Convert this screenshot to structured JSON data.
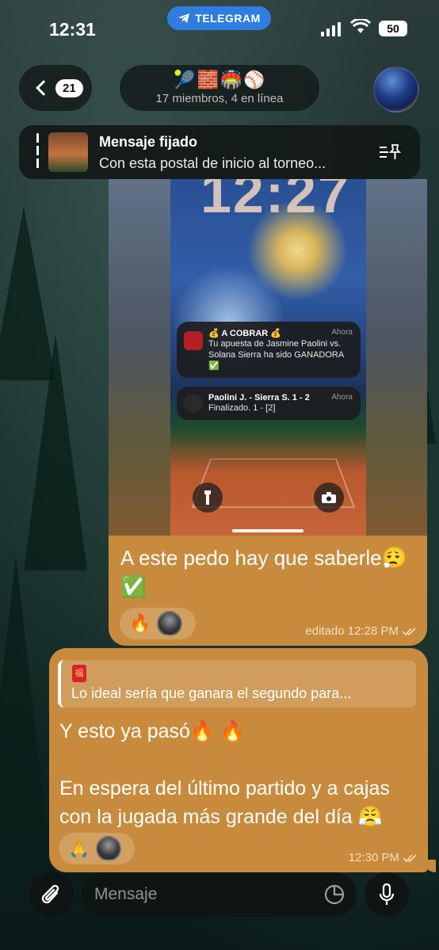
{
  "status_bar": {
    "time": "12:31",
    "app_pill": "TELEGRAM",
    "battery": "50"
  },
  "header": {
    "back_count": "21",
    "title_emojis": [
      "🎾",
      "🧱",
      "🏟️",
      "⚾"
    ],
    "subtitle": "17 miembros, 4 en línea"
  },
  "pinned": {
    "title": "Mensaje fijado",
    "text": "Con esta postal de inicio al torneo..."
  },
  "message1": {
    "screenshot": {
      "clock": "12:27",
      "notification1": {
        "title": "💰 A COBRAR 💰",
        "body": "Tu apuesta de Jasmine Paolini vs. Solana Sierra ha sido GANADORA ✅",
        "time": "Ahora"
      },
      "notification2": {
        "title": "Paolini J. - Sierra S. 1 - 2",
        "body": "Finalizado. 1 - [2]",
        "time": "Ahora"
      }
    },
    "caption": "A este pedo hay que saberle😮‍💨 ✅",
    "reaction_emoji": "🔥",
    "meta": "editado 12:28 PM"
  },
  "message2": {
    "reply_text": "Lo ideal sería que ganara el segundo para...",
    "text": "Y esto ya pasó🔥 🔥\n\nEn espera del último partido y a cajas con la jugada más grande del día 😤",
    "reaction_emoji": "🙏",
    "meta": "12:30 PM"
  },
  "input": {
    "placeholder": "Mensaje"
  },
  "colors": {
    "bubble": "#c88b3d",
    "telegram_blue": "#2f7de1"
  }
}
